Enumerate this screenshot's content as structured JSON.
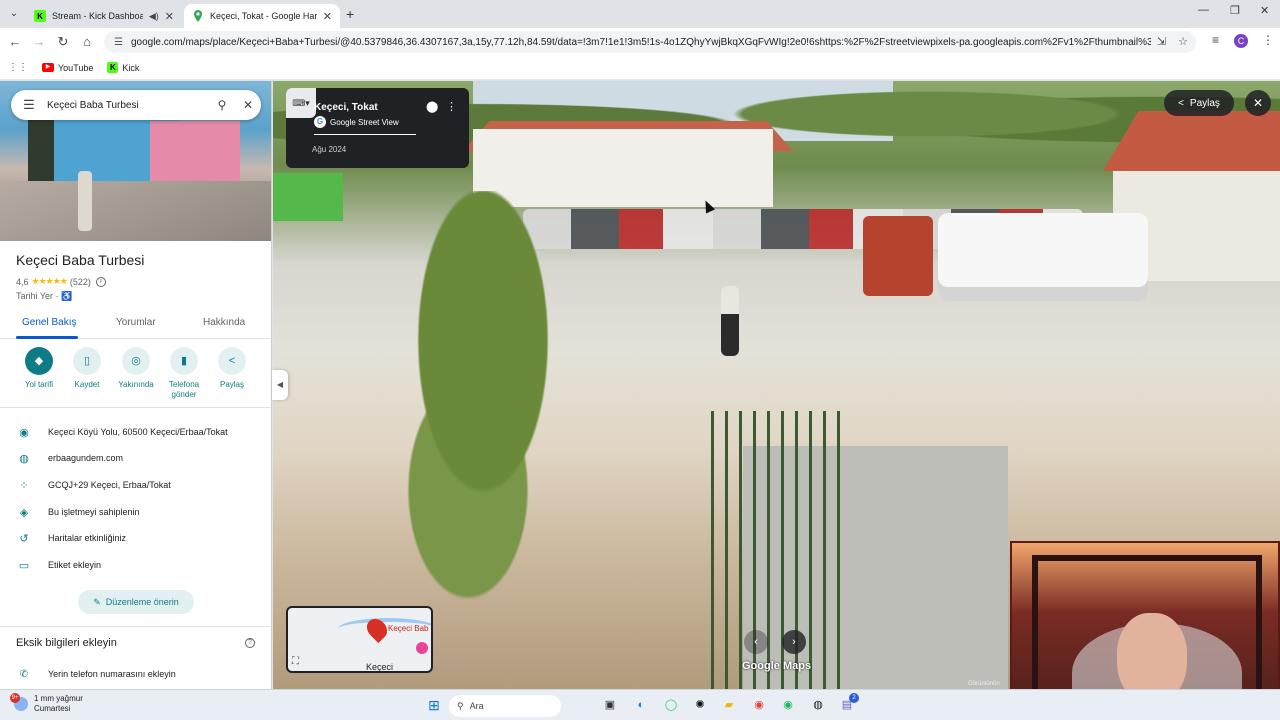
{
  "browser": {
    "tabs": [
      {
        "title": "Stream - Kick Dashboard",
        "favicon": "kick-icon"
      },
      {
        "title": "Keçeci, Tokat - Google Haritalar",
        "favicon": "google-maps-icon"
      }
    ],
    "url": "google.com/maps/place/Keçeci+Baba+Turbesi/@40.5379846,36.4307167,3a,15y,77.12h,84.59t/data=!3m7!1e1!3m5!1s-4o1ZQhyYwjBkqXGqFvWIg!2e0!6shttps:%2F%2Fstreetviewpixels-pa.googleapis.com%2Fv1%2Fthumbnail%3Fcb_client%3Dmap...",
    "bookmarks": [
      "YouTube",
      "Kick"
    ],
    "profile_initial": "C"
  },
  "panel": {
    "search_query": "Keçeci Baba Turbesi",
    "place_name": "Keçeci Baba Turbesi",
    "rating": "4,6",
    "stars": "★★★★★",
    "review_count": "(522)",
    "category": "Tarihi Yer · ",
    "accessibility_icon": "♿",
    "tabs": [
      "Genel Bakış",
      "Yorumlar",
      "Hakkında"
    ],
    "actions": [
      {
        "label": "Yol tarifi",
        "icon": "directions-icon",
        "glyph": "◆"
      },
      {
        "label": "Kaydet",
        "icon": "bookmark-icon",
        "glyph": "▯"
      },
      {
        "label": "Yakınında",
        "icon": "nearby-icon",
        "glyph": "◎"
      },
      {
        "label": "Telefona gönder",
        "icon": "send-to-phone-icon",
        "glyph": "▮"
      },
      {
        "label": "Paylaş",
        "icon": "share-icon",
        "glyph": "<"
      }
    ],
    "info": [
      {
        "text": "Keçeci Köyü Yolu, 60500 Keçeci/Erbaa/Tokat",
        "icon": "location-pin-icon",
        "glyph": "◉"
      },
      {
        "text": "erbaagundem.com",
        "icon": "globe-icon",
        "glyph": "◍"
      },
      {
        "text": "GCQJ+29 Keçeci, Erbaa/Tokat",
        "icon": "plus-code-icon",
        "glyph": "⁘"
      },
      {
        "text": "Bu işletmeyi sahiplenin",
        "icon": "verified-shield-icon",
        "glyph": "◈"
      },
      {
        "text": "Haritalar etkinliğiniz",
        "icon": "history-icon",
        "glyph": "↺"
      },
      {
        "text": "Etiket ekleyin",
        "icon": "label-icon",
        "glyph": "▭"
      }
    ],
    "suggest_edit": "Düzenleme önerin",
    "missing_title": "Eksik bilgileri ekleyin",
    "missing_items": [
      {
        "text": "Yerin telefon numarasını ekleyin",
        "icon": "phone-icon",
        "glyph": "✆"
      }
    ]
  },
  "streetview": {
    "location": "Keçeci, Tokat",
    "brand": "Google Street View",
    "date": "Ağu 2024",
    "share_label": "Paylaş",
    "minimap_label": "Keçeci Bab",
    "minimap_town": "Keçeci",
    "logo": "Google Maps",
    "credit": "Görüntünün"
  },
  "taskbar": {
    "weather_line1": "1 mm yağmur",
    "weather_line2": "Cumartesi",
    "weather_badge": "9+",
    "search_placeholder": "Ara",
    "notification_count": "2"
  }
}
